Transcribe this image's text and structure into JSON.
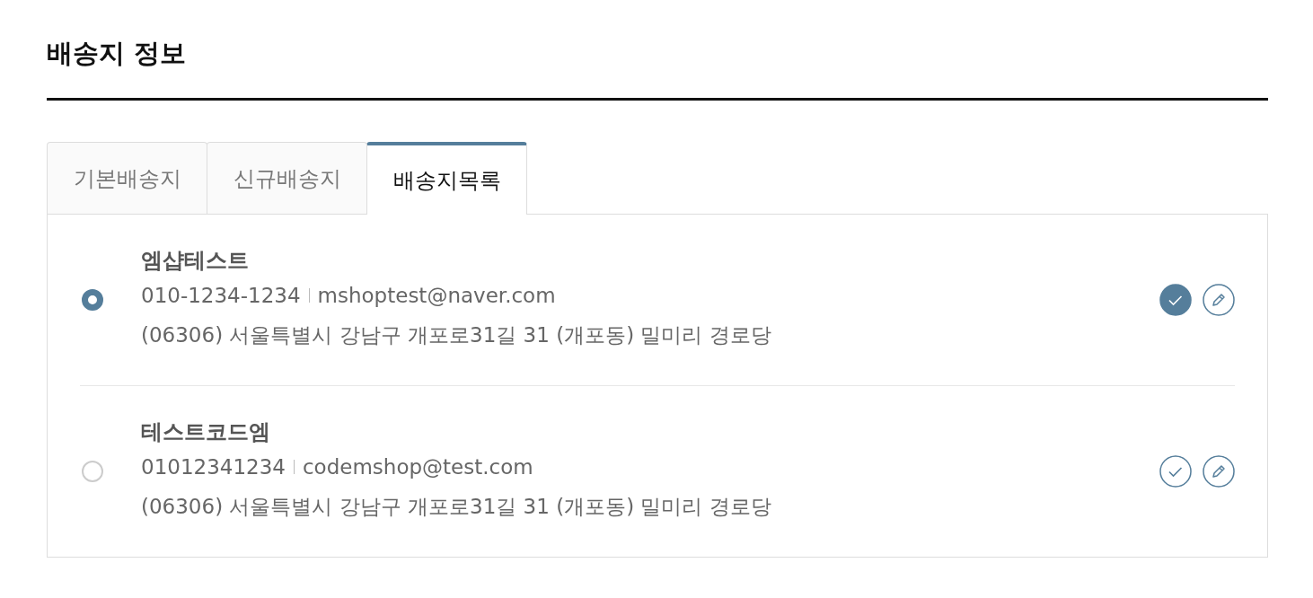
{
  "section_title": "배송지 정보",
  "tabs": [
    {
      "label": "기본배송지",
      "selected": false
    },
    {
      "label": "신규배송지",
      "selected": false
    },
    {
      "label": "배송지목록",
      "selected": true
    }
  ],
  "addresses": [
    {
      "name": "엠샵테스트",
      "phone": "010-1234-1234",
      "email": "mshoptest@naver.com",
      "address": "(06306) 서울특별시 강남구 개포로31길 31 (개포동) 밀미리 경로당",
      "selected": true,
      "is_default": true
    },
    {
      "name": "테스트코드엠",
      "phone": "01012341234",
      "email": "codemshop@test.com",
      "address": "(06306) 서울특별시 강남구 개포로31길 31 (개포동) 밀미리 경로당",
      "selected": false,
      "is_default": false
    }
  ]
}
